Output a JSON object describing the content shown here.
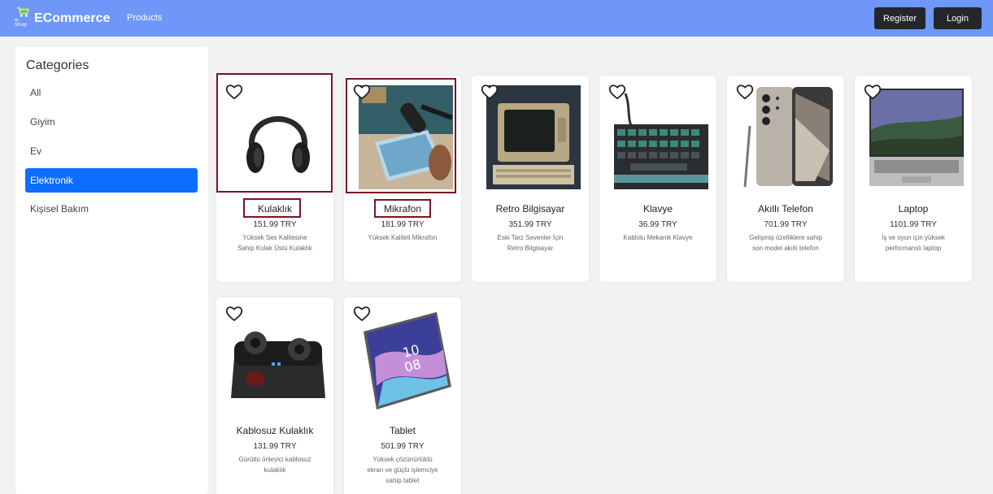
{
  "navbar": {
    "logo_small": "e-Shop",
    "brand": "ECommerce",
    "products_link": "Products",
    "register": "Register",
    "login": "Login",
    "bg_color": "#6e97f7"
  },
  "sidebar": {
    "title": "Categories",
    "items": [
      {
        "label": "All",
        "active": false
      },
      {
        "label": "Giyim",
        "active": false
      },
      {
        "label": "Ev",
        "active": false
      },
      {
        "label": "Elektronik",
        "active": true
      },
      {
        "label": "Kişisel Bakım",
        "active": false
      }
    ],
    "active_color": "#0d6efd"
  },
  "products": [
    {
      "name": "Kulaklık",
      "price": "151.99 TRY",
      "description": "Yüksek Ses Kalitesine Sahip Kulak Üstü Kulaklık",
      "image": "headphones",
      "highlighted": true
    },
    {
      "name": "Mikrafon",
      "price": "181.99 TRY",
      "description": "Yüksek Kaliteli Mikrafon",
      "image": "microphone",
      "highlighted": true
    },
    {
      "name": "Retro Bilgisayar",
      "price": "351.99 TRY",
      "description": "Eski Tarz Sevenler İçin Retro Bilgisayar",
      "image": "retro-computer",
      "highlighted": false
    },
    {
      "name": "Klavye",
      "price": "36.99 TRY",
      "description": "Kablolu Mekanik Klavye",
      "image": "keyboard",
      "highlighted": false
    },
    {
      "name": "Akıllı Telefon",
      "price": "701.99 TRY",
      "description": "Gelişmiş özelliklere sahip son model akıllı telefon",
      "image": "smartphone",
      "highlighted": false
    },
    {
      "name": "Laptop",
      "price": "1101.99 TRY",
      "description": "İş ve oyun için yüksek performanslı laptop",
      "image": "laptop",
      "highlighted": false
    },
    {
      "name": "Kablosuz Kulaklık",
      "price": "131.99 TRY",
      "description": "Gürültü önleyici kablosuz kulaklık",
      "image": "earbuds",
      "highlighted": false
    },
    {
      "name": "Tablet",
      "price": "501.99 TRY",
      "description": "Yüksek çözünürlüklü ekran ve güçlü işlemciye sahip tablet",
      "image": "tablet",
      "highlighted": false
    }
  ],
  "highlight_color": "#7a1424"
}
